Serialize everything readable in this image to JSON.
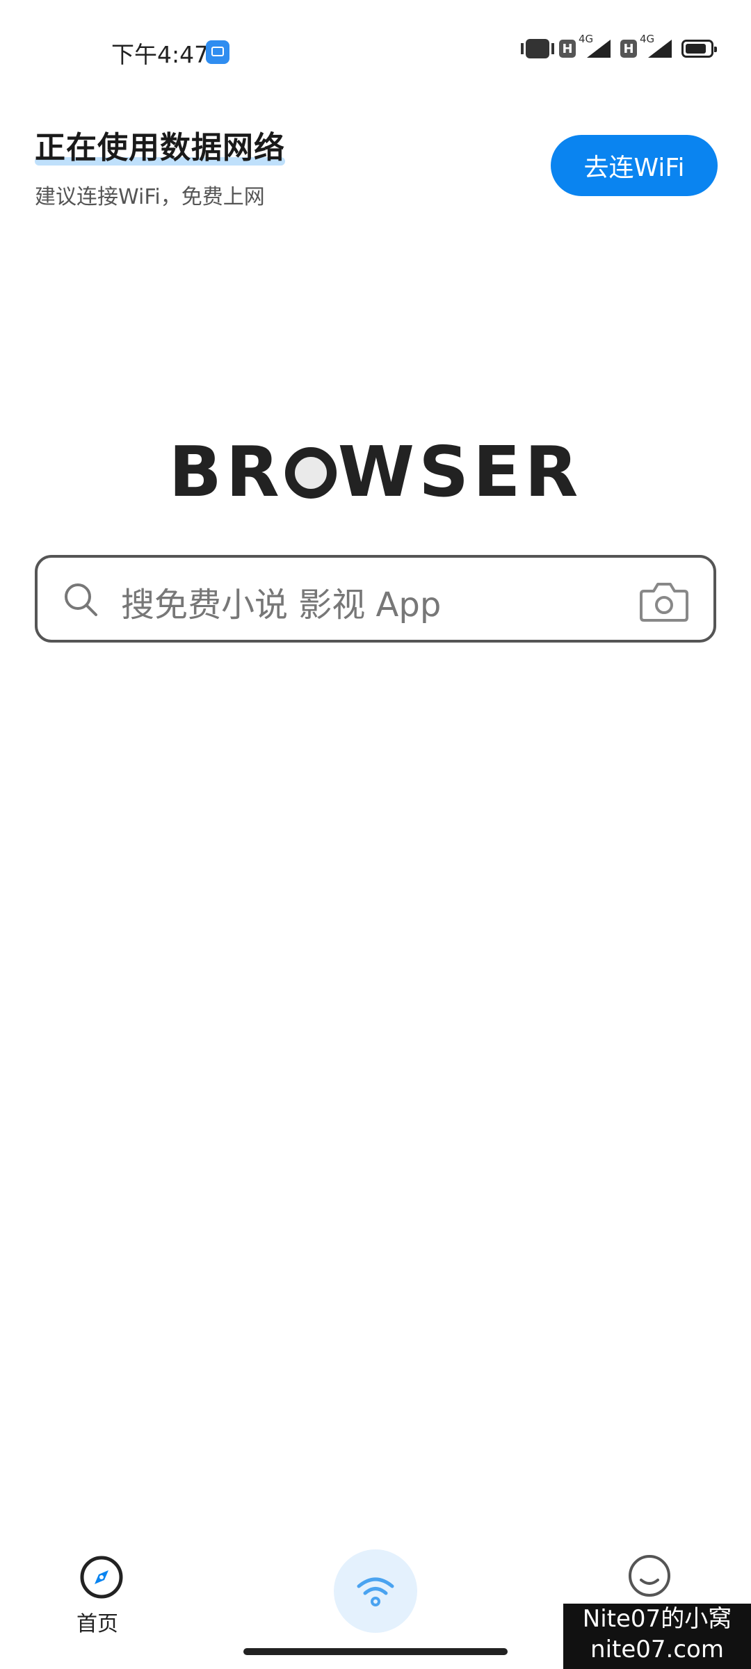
{
  "status_bar": {
    "time": "下午4:47",
    "signal_1": {
      "badge": "H",
      "network": "4G"
    },
    "signal_2": {
      "badge": "H",
      "network": "4G"
    }
  },
  "banner": {
    "title": "正在使用数据网络",
    "subtitle": "建议连接WiFi，免费上网",
    "connect_button": "去连WiFi"
  },
  "logo": {
    "text_left": "BR",
    "text_right": "WSER"
  },
  "search": {
    "placeholder": "搜免费小说 影视 App"
  },
  "bottom_nav": {
    "home_label": "首页"
  },
  "watermark": {
    "line1": "Nite07的小窝",
    "line2": "nite07.com"
  },
  "colors": {
    "accent": "#0a84f0",
    "wifi_bg": "#e4f1fd"
  }
}
